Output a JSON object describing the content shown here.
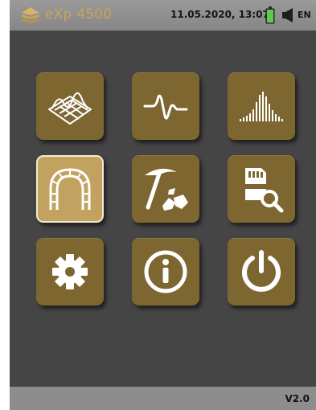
{
  "header": {
    "app_title": "eXp 4500",
    "datetime": "11.05.2020, 13:07",
    "language": "EN",
    "icons": [
      "logo-icon",
      "battery-icon",
      "speaker-icon"
    ]
  },
  "menu": {
    "tiles": [
      {
        "icon": "3d-ground-scan-icon"
      },
      {
        "icon": "pulse-signal-icon"
      },
      {
        "icon": "histogram-icon"
      },
      {
        "icon": "tunnel-icon",
        "selected": true
      },
      {
        "icon": "pickaxe-minerals-icon"
      },
      {
        "icon": "sd-card-search-icon"
      },
      {
        "icon": "gear-icon"
      },
      {
        "icon": "info-icon"
      },
      {
        "icon": "power-icon"
      }
    ]
  },
  "footer": {
    "version": "V2.0"
  },
  "colors": {
    "accent": "#c9a45a",
    "tile": "#7e6631",
    "tile_selected": "#c2a261",
    "background": "#454545",
    "bar": "#8d8d8d",
    "battery": "#5ecb4a"
  }
}
